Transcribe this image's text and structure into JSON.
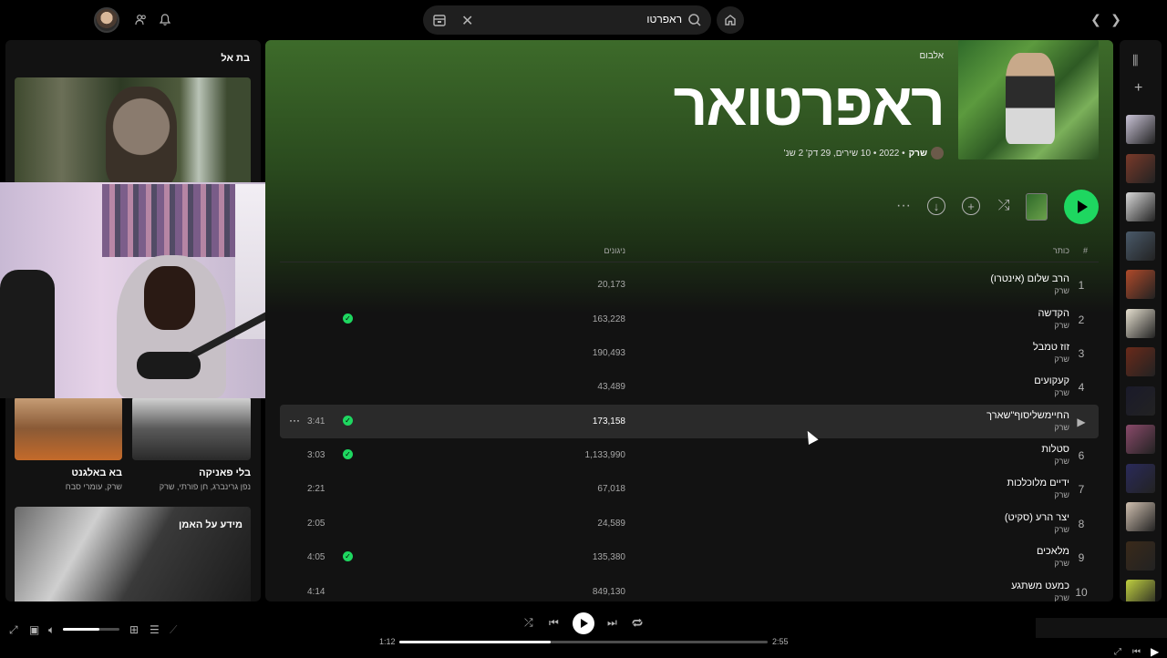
{
  "search": {
    "query": "ראפרטו"
  },
  "left_panel": {
    "title": "בת אל",
    "cards": [
      {
        "title": "בלי פאניקה",
        "subtitle": "נפן גרינברג, חן פורתי, שרק"
      },
      {
        "title": "בא באלגנט",
        "subtitle": "שרק, עומרי סבח"
      }
    ],
    "about_label": "מידע על האמן"
  },
  "album": {
    "type_label": "אלבום",
    "title": "ראפרטואר",
    "artist": "שרק",
    "meta": "• 2022 • 10 שירים, 29 דק' 2 שנ'"
  },
  "columns": {
    "number": "#",
    "title": "כותר",
    "plays": "ניגונים"
  },
  "tracks": [
    {
      "n": "1",
      "title": "הרב שלום (אינטרו)",
      "artist": "שרק",
      "plays": "20,173",
      "duration": "",
      "saved": false
    },
    {
      "n": "2",
      "title": "הקדשה",
      "artist": "שרק",
      "plays": "163,228",
      "duration": "",
      "saved": true
    },
    {
      "n": "3",
      "title": "זוז טמבל",
      "artist": "שרק",
      "plays": "190,493",
      "duration": "",
      "saved": false
    },
    {
      "n": "4",
      "title": "קעקועים",
      "artist": "שרק",
      "plays": "43,489",
      "duration": "",
      "saved": false
    },
    {
      "n": "▶",
      "title": "החיימשליסוף\"שארך",
      "artist": "שרק",
      "plays": "173,158",
      "duration": "3:41",
      "saved": true,
      "active": true
    },
    {
      "n": "6",
      "title": "סטלות",
      "artist": "שרק",
      "plays": "1,133,990",
      "duration": "3:03",
      "saved": true
    },
    {
      "n": "7",
      "title": "ידיים מלוכלכות",
      "artist": "שרק",
      "plays": "67,018",
      "duration": "2:21",
      "saved": false
    },
    {
      "n": "8",
      "title": "יצר הרע (סקיט)",
      "artist": "שרק",
      "plays": "24,589",
      "duration": "2:05",
      "saved": false
    },
    {
      "n": "9",
      "title": "מלאכים",
      "artist": "שרק",
      "plays": "135,380",
      "duration": "4:05",
      "saved": true
    },
    {
      "n": "10",
      "title": "כמעט משתגע",
      "artist": "שרק",
      "plays": "849,130",
      "duration": "4:14",
      "saved": false
    }
  ],
  "player": {
    "elapsed": "1:12",
    "total": "2:55",
    "progress": 0.41,
    "volume": 0.65
  },
  "colors": {
    "accent": "#1ed760",
    "header_green": "#3d6b2a",
    "background": "#121212"
  },
  "icons": [
    "avatar",
    "friends-icon",
    "bell-icon",
    "browse-icon",
    "clear-icon",
    "search-icon",
    "home-icon",
    "back-icon",
    "forward-icon",
    "library-icon",
    "add-icon",
    "more-icon",
    "download-icon",
    "add-circle-icon",
    "shuffle-icon",
    "play-icon",
    "check-icon",
    "previous-icon",
    "next-icon",
    "repeat-icon",
    "fullscreen-icon",
    "miniplayer-icon",
    "volume-icon",
    "connect-icon",
    "queue-icon",
    "lyrics-icon"
  ]
}
